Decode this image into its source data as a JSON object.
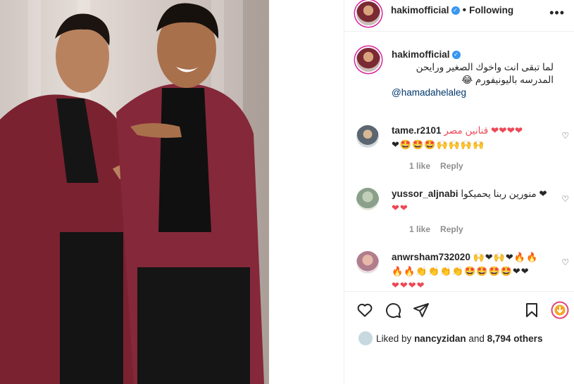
{
  "post": {
    "username": "hakimofficial",
    "following_label": "Following",
    "more_label": "•••",
    "caption": {
      "username": "hakimofficial",
      "text": "لما تبقى انت واخوك الصغير ورايحن المدرسه باليونيفورم 😂",
      "mention": "@hamadahelaleg"
    }
  },
  "comments": [
    {
      "username": "tame.r2101",
      "text": "قنانين مصر ❤❤❤❤",
      "emojis": "❤🤩🤩🤩🙌🙌🙌🙌",
      "likes_label": "1 like",
      "reply_label": "Reply"
    },
    {
      "username": "yussor_aljnabi",
      "text": "منورين ربنا يحميكوا ❤",
      "emojis": "❤❤",
      "likes_label": "1 like",
      "reply_label": "Reply"
    },
    {
      "username": "anwrsham732020",
      "text": "🙌❤🙌❤🔥🔥",
      "emojis": "🔥🔥👏👏👏👏🤩🤩🤩🤩❤❤",
      "emojis2": "❤❤❤❤"
    }
  ],
  "likes": {
    "prefix": "Liked by",
    "user": "nancyzidan",
    "and": "and",
    "count": "8,794 others"
  },
  "colors": {
    "accent_link": "#00376b",
    "verified": "#3897f0",
    "muted": "#8e8e8e",
    "heart": "#ed4956"
  }
}
